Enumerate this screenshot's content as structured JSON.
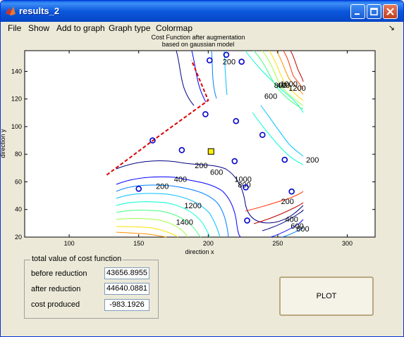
{
  "window": {
    "title": "results_2"
  },
  "menu": [
    "File",
    "Show",
    "Add to graph",
    "Graph type",
    "Colormap"
  ],
  "chart_data": {
    "type": "contour",
    "title": "Cost Function after augmentation\nbased on gaussian model",
    "title_lines": [
      "Cost Function after augmentation",
      "based on gaussian model"
    ],
    "xlabel": "direction x",
    "ylabel": "direction y",
    "xlim": [
      68,
      320
    ],
    "ylim": [
      20,
      155
    ],
    "xticks": [
      100,
      150,
      200,
      250,
      300
    ],
    "yticks": [
      20,
      40,
      60,
      80,
      100,
      120,
      140
    ],
    "contour_labels": [
      {
        "text": "200",
        "x": 215,
        "y": 145
      },
      {
        "text": "400",
        "x": 254,
        "y": 128
      },
      {
        "text": "600",
        "x": 245,
        "y": 120
      },
      {
        "text": "800",
        "x": 252,
        "y": 128
      },
      {
        "text": "1000",
        "x": 258,
        "y": 129
      },
      {
        "text": "1200",
        "x": 264,
        "y": 126
      },
      {
        "text": "200",
        "x": 275,
        "y": 74
      },
      {
        "text": "200",
        "x": 167,
        "y": 55
      },
      {
        "text": "400",
        "x": 180,
        "y": 60
      },
      {
        "text": "600",
        "x": 206,
        "y": 65
      },
      {
        "text": "1000",
        "x": 225,
        "y": 60
      },
      {
        "text": "800",
        "x": 226,
        "y": 56
      },
      {
        "text": "1200",
        "x": 189,
        "y": 41
      },
      {
        "text": "1400",
        "x": 183,
        "y": 29
      },
      {
        "text": "200",
        "x": 257,
        "y": 44
      },
      {
        "text": "400",
        "x": 260,
        "y": 31
      },
      {
        "text": "600",
        "x": 264,
        "y": 26
      },
      {
        "text": "800",
        "x": 268,
        "y": 24
      },
      {
        "text": "200",
        "x": 195,
        "y": 70
      }
    ],
    "points": [
      {
        "x": 201,
        "y": 148
      },
      {
        "x": 213,
        "y": 152
      },
      {
        "x": 224,
        "y": 147
      },
      {
        "x": 198,
        "y": 109
      },
      {
        "x": 220,
        "y": 104
      },
      {
        "x": 239,
        "y": 94
      },
      {
        "x": 160,
        "y": 90
      },
      {
        "x": 181,
        "y": 83
      },
      {
        "x": 219,
        "y": 75
      },
      {
        "x": 255,
        "y": 76
      },
      {
        "x": 227,
        "y": 56
      },
      {
        "x": 150,
        "y": 55
      },
      {
        "x": 260,
        "y": 53
      },
      {
        "x": 228,
        "y": 32
      }
    ],
    "selected_point": {
      "x": 202,
      "y": 82
    },
    "boundary_line": [
      [
        127,
        65
      ],
      [
        163,
        92
      ],
      [
        200,
        119
      ],
      [
        188,
        148
      ]
    ],
    "colors": {
      "points": "#0000cc",
      "boundary": "#dd0000",
      "selected": "#ffee00"
    }
  },
  "cost_panel": {
    "title": "total value of cost function",
    "before_label": "before reduction",
    "before_value": "43656.8955",
    "after_label": "after reduction",
    "after_value": "44640.0881",
    "produced_label": "cost produced",
    "produced_value": "-983.1926"
  },
  "plot_button": "PLOT"
}
